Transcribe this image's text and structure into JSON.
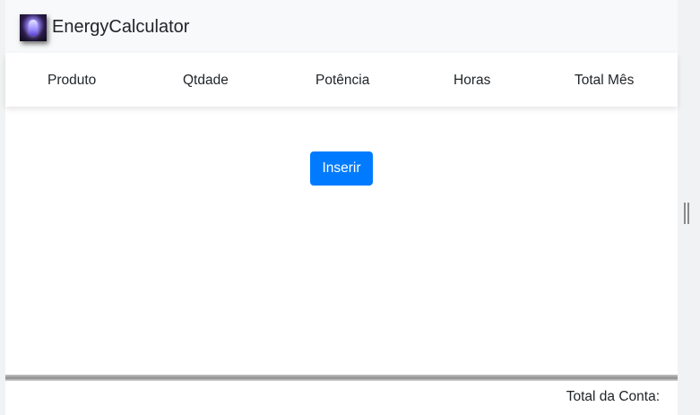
{
  "navbar": {
    "brand_name": "EnergyCalculator",
    "logo_icon": "energy-bulb-icon"
  },
  "table": {
    "headers": [
      "Produto",
      "Qtdade",
      "Potência",
      "Horas",
      "Total Mês"
    ]
  },
  "actions": {
    "insert_label": "Inserir"
  },
  "footer": {
    "total_label": "Total da Conta:"
  },
  "colors": {
    "primary": "#007bff",
    "navbar_bg": "#f8f9fa",
    "text": "#212529"
  }
}
